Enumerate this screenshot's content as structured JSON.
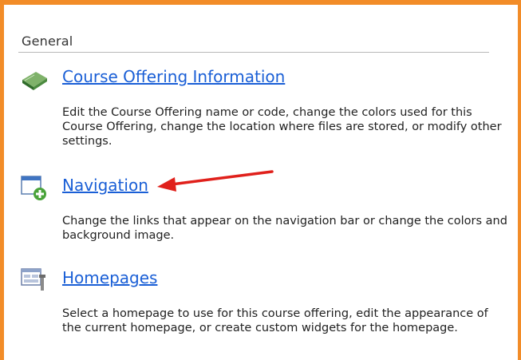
{
  "section": {
    "title": "General"
  },
  "items": [
    {
      "label": "Course Offering Information",
      "description": "Edit the Course Offering name or code, change the colors used for this Course Offering, change the location where files are stored, or modify other settings.",
      "icon": "book-icon"
    },
    {
      "label": "Navigation",
      "description": "Change the links that appear on the navigation bar or change the colors and background image.",
      "icon": "navbar-add-icon"
    },
    {
      "label": "Homepages",
      "description": "Select a homepage to use for this course offering, edit the appearance of the current homepage, or create custom widgets for the homepage.",
      "icon": "homepage-tools-icon"
    }
  ],
  "colors": {
    "border": "#f28c28",
    "link": "#1a5fd6",
    "arrow": "#e0201b"
  }
}
